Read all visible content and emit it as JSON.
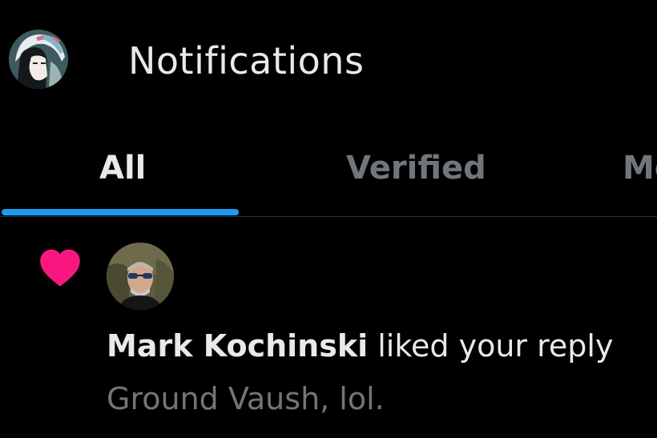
{
  "header": {
    "title": "Notifications",
    "avatar_icon": "anime-avatar-icon"
  },
  "tabs": [
    {
      "label": "All",
      "active": true
    },
    {
      "label": "Verified",
      "active": false
    },
    {
      "label": "Me",
      "active": false
    }
  ],
  "notification": {
    "icon": "heart-icon",
    "user_name": "Mark Kochinski",
    "action": "liked your reply",
    "reply_text": "Ground Vaush, lol."
  },
  "colors": {
    "background": "#000000",
    "text_primary": "#e7e9ea",
    "text_secondary": "#71767b",
    "accent": "#1d9bf0",
    "like": "#f91880",
    "divider": "#2f3336"
  }
}
